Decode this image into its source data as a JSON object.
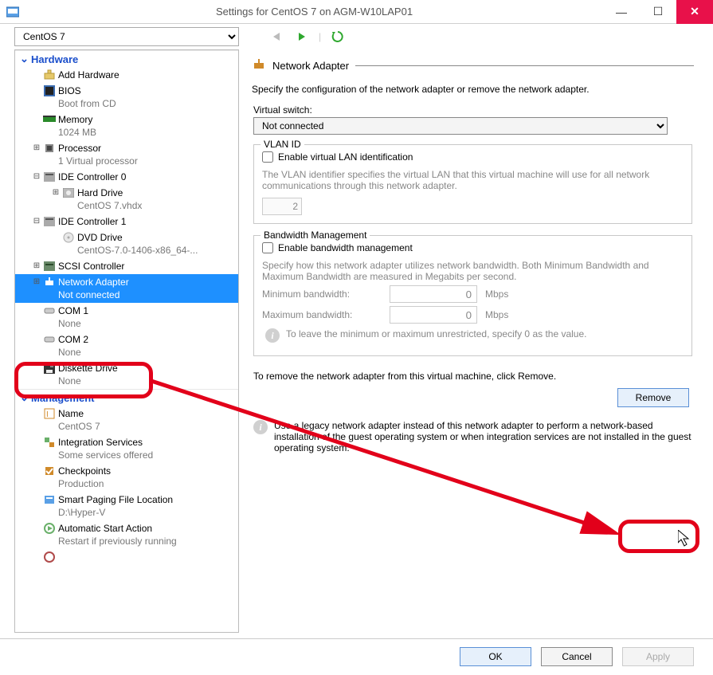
{
  "window": {
    "title": "Settings for CentOS 7 on AGM-W10LAP01"
  },
  "vm_select": {
    "value": "CentOS 7"
  },
  "sections": {
    "hardware": {
      "label": "Hardware"
    },
    "management": {
      "label": "Management"
    }
  },
  "tree": {
    "add_hw": {
      "label": "Add Hardware"
    },
    "bios": {
      "label": "BIOS",
      "sub": "Boot from CD"
    },
    "memory": {
      "label": "Memory",
      "sub": "1024 MB"
    },
    "processor": {
      "label": "Processor",
      "sub": "1 Virtual processor"
    },
    "ide0": {
      "label": "IDE Controller 0"
    },
    "hard_drive": {
      "label": "Hard Drive",
      "sub": "CentOS 7.vhdx"
    },
    "ide1": {
      "label": "IDE Controller 1"
    },
    "dvd": {
      "label": "DVD Drive",
      "sub": "CentOS-7.0-1406-x86_64-..."
    },
    "scsi": {
      "label": "SCSI Controller"
    },
    "net": {
      "label": "Network Adapter",
      "sub": "Not connected"
    },
    "com1": {
      "label": "COM 1",
      "sub": "None"
    },
    "com2": {
      "label": "COM 2",
      "sub": "None"
    },
    "diskette": {
      "label": "Diskette Drive",
      "sub": "None"
    },
    "name": {
      "label": "Name",
      "sub": "CentOS 7"
    },
    "integ": {
      "label": "Integration Services",
      "sub": "Some services offered"
    },
    "chkpts": {
      "label": "Checkpoints",
      "sub": "Production"
    },
    "paging": {
      "label": "Smart Paging File Location",
      "sub": "D:\\Hyper-V"
    },
    "autostart": {
      "label": "Automatic Start Action",
      "sub": "Restart if previously running"
    }
  },
  "panel": {
    "title": "Network Adapter",
    "desc": "Specify the configuration of the network adapter or remove the network adapter.",
    "vswitch_label": "Virtual switch:",
    "vswitch_value": "Not connected",
    "vlan": {
      "legend": "VLAN ID",
      "check": "Enable virtual LAN identification",
      "desc": "The VLAN identifier specifies the virtual LAN that this virtual machine will use for all network communications through this network adapter.",
      "value": "2"
    },
    "bw": {
      "legend": "Bandwidth Management",
      "check": "Enable bandwidth management",
      "desc": "Specify how this network adapter utilizes network bandwidth. Both Minimum Bandwidth and Maximum Bandwidth are measured in Megabits per second.",
      "min_label": "Minimum bandwidth:",
      "min_val": "0",
      "max_label": "Maximum bandwidth:",
      "max_val": "0",
      "unit": "Mbps",
      "note": "To leave the minimum or maximum unrestricted, specify 0 as the value."
    },
    "remove_text": "To remove the network adapter from this virtual machine, click Remove.",
    "remove_btn": "Remove",
    "legacy_note": "Use a legacy network adapter instead of this network adapter to perform a network-based installation of the guest operating system or when integration services are not installed in the guest operating system."
  },
  "footer": {
    "ok": "OK",
    "cancel": "Cancel",
    "apply": "Apply"
  }
}
